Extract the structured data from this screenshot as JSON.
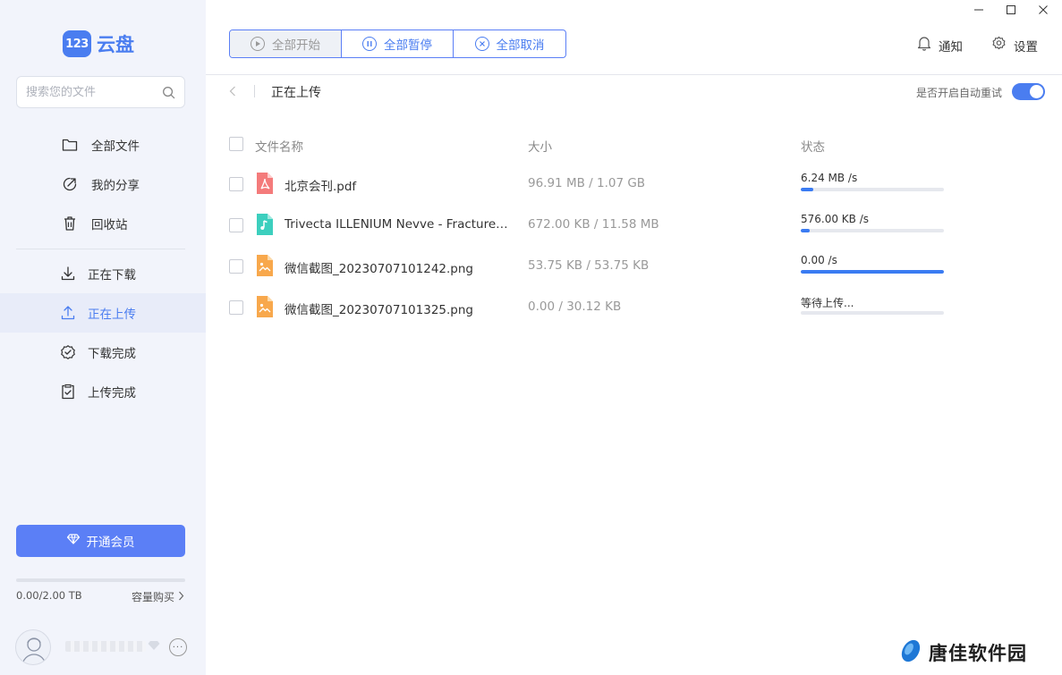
{
  "app": {
    "logo_badge": "123",
    "logo_text": "云盘"
  },
  "search": {
    "placeholder": "搜索您的文件"
  },
  "sidebar": {
    "files_nav": [
      {
        "label": "全部文件",
        "icon": "folder-icon"
      },
      {
        "label": "我的分享",
        "icon": "share-icon"
      },
      {
        "label": "回收站",
        "icon": "trash-icon"
      }
    ],
    "transfer_nav": [
      {
        "label": "正在下载",
        "icon": "download-icon",
        "active": false
      },
      {
        "label": "正在上传",
        "icon": "upload-icon",
        "active": true
      },
      {
        "label": "下载完成",
        "icon": "download-done-icon",
        "active": false
      },
      {
        "label": "上传完成",
        "icon": "upload-done-icon",
        "active": false
      }
    ],
    "vip_button": "开通会员",
    "storage_text": "0.00/2.00 TB",
    "storage_used_fraction": 0,
    "buy_link": "容量购买"
  },
  "toolbar": {
    "start_all": "全部开始",
    "pause_all": "全部暂停",
    "cancel_all": "全部取消"
  },
  "header": {
    "notify": "通知",
    "settings": "设置"
  },
  "page": {
    "title": "正在上传",
    "auto_retry_label": "是否开启自动重试",
    "auto_retry_on": true
  },
  "table": {
    "columns": {
      "name": "文件名称",
      "size": "大小",
      "status": "状态"
    },
    "rows": [
      {
        "name": "北京会刊.pdf",
        "size": "96.91 MB / 1.07 GB",
        "status": "6.24 MB /s",
        "progress": 0.09,
        "type": "pdf"
      },
      {
        "name": "Trivecta ILLENIUM Nevve - Fractures T...",
        "size": "672.00 KB / 11.58 MB",
        "status": "576.00 KB /s",
        "progress": 0.06,
        "type": "audio"
      },
      {
        "name": "微信截图_20230707101242.png",
        "size": "53.75 KB / 53.75 KB",
        "status": "0.00 /s",
        "progress": 1.0,
        "type": "image"
      },
      {
        "name": "微信截图_20230707101325.png",
        "size": "0.00 / 30.12 KB",
        "status": "等待上传...",
        "progress": 0,
        "type": "image"
      }
    ]
  },
  "watermark": {
    "text": "唐佳软件园"
  },
  "colors": {
    "accent": "#4a7df0",
    "vip_button": "#5b7ff6",
    "sidebar_bg": "#f2f4fb",
    "active_item_bg": "#e8ecf9",
    "progress_fill": "#3a7bf2",
    "pdf_icon": "#f47b7b",
    "audio_icon": "#3ccfbe",
    "image_icon": "#f8a84c"
  }
}
